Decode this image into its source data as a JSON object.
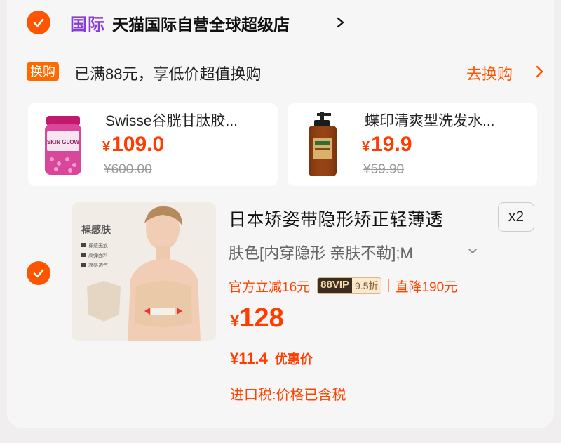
{
  "store": {
    "tag": "国际",
    "name": "天猫国际自营全球超级店"
  },
  "promo": {
    "badge": "换购",
    "text": "已满88元，享低价超值换购",
    "link": "去换购"
  },
  "addons": [
    {
      "title": "Swisse谷胱甘肽胶...",
      "yen": "¥",
      "price": "109.0",
      "original": "¥600.00",
      "image_caption": "SKIN GLOW"
    },
    {
      "title": "蝶印清爽型洗发水...",
      "yen": "¥",
      "price": "19.9",
      "original": "¥59.90"
    }
  ],
  "item": {
    "title": "日本矫姿带隐形矫正轻薄透",
    "quantity": "x2",
    "sku": "肤色[内穿隐形 亲肤不勒];M",
    "promo_discount": "官方立减16元",
    "vip_tag": "88VIP",
    "vip_rate": "9.5折",
    "promo_drop": "直降190元",
    "yen": "¥",
    "price": "128",
    "deal_price": "¥11.4",
    "deal_label": "优惠价",
    "tax": "进口税:价格已含税",
    "image": {
      "headline": "裸感肤",
      "features": [
        "裸感无痕",
        "高弹面料",
        "凉感透气"
      ]
    }
  },
  "colors": {
    "accent": "#ff5500",
    "price": "#ff3d00",
    "intl": "#8a3dd6"
  }
}
